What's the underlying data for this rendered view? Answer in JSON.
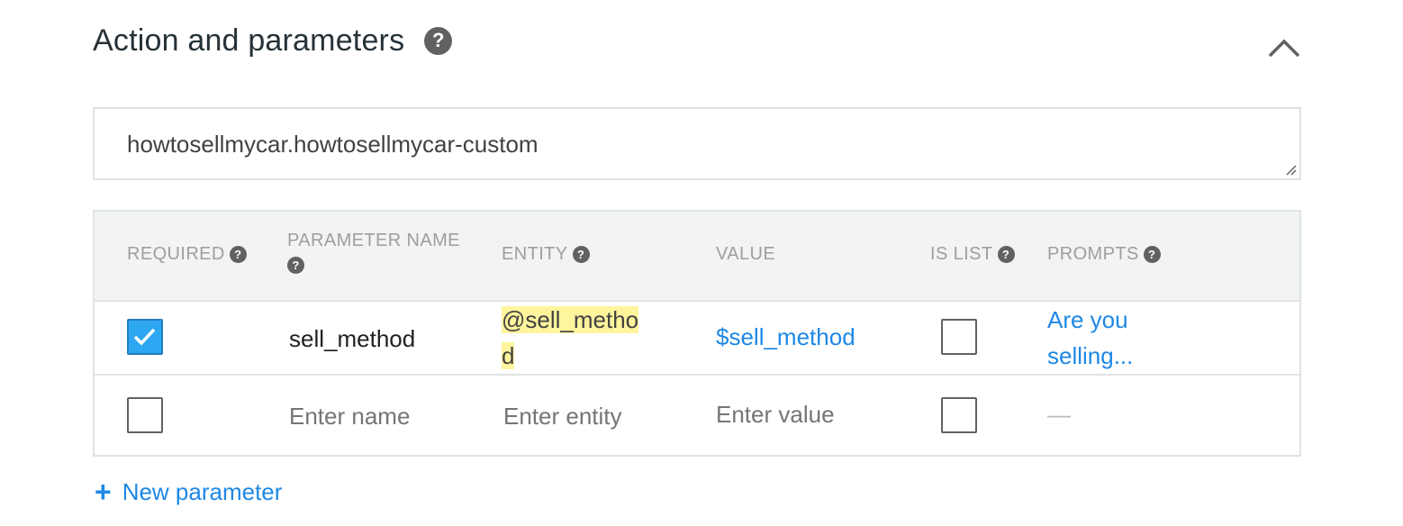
{
  "section": {
    "title": "Action and parameters",
    "help_glyph": "?",
    "collapse_icon": "chevron-up-icon"
  },
  "action": {
    "value": "howtosellmycar.howtosellmycar-custom"
  },
  "table": {
    "headers": {
      "required": "REQUIRED",
      "parameter_name": "PARAMETER NAME",
      "entity": "ENTITY",
      "value": "VALUE",
      "is_list": "IS LIST",
      "prompts": "PROMPTS"
    },
    "rows": [
      {
        "required": true,
        "name": "sell_method",
        "entity": "@sell_method",
        "value": "$sell_method",
        "is_list": false,
        "prompts": "Are you selling..."
      }
    ],
    "new_row": {
      "required": false,
      "name_placeholder": "Enter name",
      "entity_placeholder": "Enter entity",
      "value_placeholder": "Enter value",
      "is_list": false,
      "prompts": "—"
    }
  },
  "new_parameter": {
    "plus": "+",
    "label": "New parameter"
  },
  "colors": {
    "accent": "#1e88e5",
    "checkbox_checked": "#2ea7f2",
    "entity_highlight": "#fff59d",
    "header_bg": "#f2f3f3"
  }
}
